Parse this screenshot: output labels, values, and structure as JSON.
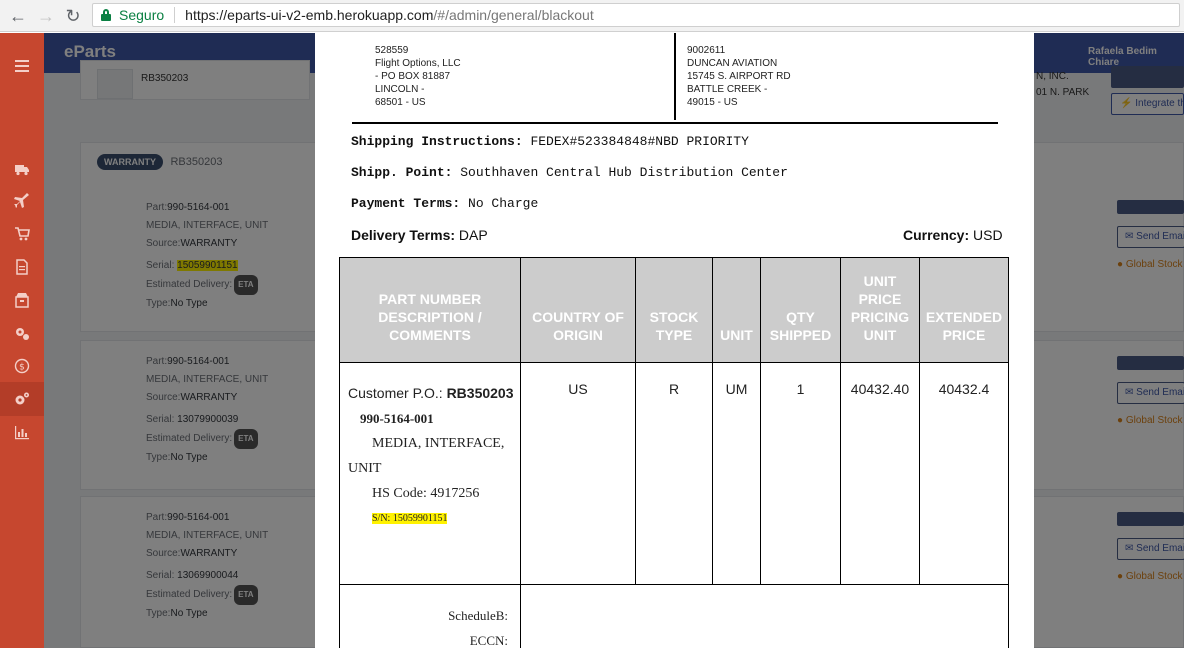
{
  "browser": {
    "secure_label": "Seguro",
    "url_host": "https://eparts-ui-v2-emb.herokuapp.com",
    "url_path": "/#/admin/general/blackout"
  },
  "app": {
    "brand": "eParts",
    "user": "Rafaela Bedim Chiare",
    "header_id": "RB350203",
    "right_partial_1": "N, INC.",
    "right_partial_2": "01 N. PARK",
    "integrate_label": "Integrate this",
    "send_email_label": "Send Email",
    "global_stock_label": "Global Stock"
  },
  "background_cards": [
    {
      "badge": "WARRANTY",
      "id": "RB350203",
      "part_label": "Part:",
      "part": "990-5164-001",
      "description": "MEDIA, INTERFACE, UNIT",
      "source_label": "Source:",
      "source": "WARRANTY",
      "serial_label": "Serial:",
      "serial": "15059901151",
      "eta_label": "Estimated Delivery:",
      "eta_badge": "ETA",
      "type_label": "Type:",
      "type": "No Type"
    },
    {
      "part_label": "Part:",
      "part": "990-5164-001",
      "description": "MEDIA, INTERFACE, UNIT",
      "source_label": "Source:",
      "source": "WARRANTY",
      "serial_label": "Serial:",
      "serial": "13079900039",
      "eta_label": "Estimated Delivery:",
      "eta_badge": "ETA",
      "type_label": "Type:",
      "type": "No Type"
    },
    {
      "part_label": "Part:",
      "part": "990-5164-001",
      "description": "MEDIA, INTERFACE, UNIT",
      "source_label": "Source:",
      "source": "WARRANTY",
      "serial_label": "Serial:",
      "serial": "13069900044",
      "eta_label": "Estimated Delivery:",
      "eta_badge": "ETA",
      "type_label": "Type:",
      "type": "No Type"
    }
  ],
  "document": {
    "ship_from": "528559\nFlight Options, LLC\n- PO BOX 81887\nLINCOLN -\n68501 - US",
    "ship_to": "9002611\nDUNCAN AVIATION\n15745 S. AIRPORT RD\nBATTLE CREEK -\n49015 - US",
    "shipping_instructions_label": "Shipping Instructions:",
    "shipping_instructions": "FEDEX#523384848#NBD PRIORITY",
    "shipping_point_label": "Shipp. Point:",
    "shipping_point": "Southhaven Central Hub Distribution Center",
    "payment_terms_label": "Payment Terms:",
    "payment_terms": "No Charge",
    "delivery_terms_label": "Delivery Terms:",
    "delivery_terms": "DAP",
    "currency_label": "Currency:",
    "currency": "USD",
    "columns": [
      "PART NUMBER DESCRIPTION / COMMENTS",
      "COUNTRY OF ORIGIN",
      "STOCK TYPE",
      "UNIT",
      "QTY SHIPPED",
      "UNIT PRICE PRICING UNIT",
      "EXTENDED PRICE"
    ],
    "row": {
      "customer_po_label": "Customer P.O.:",
      "customer_po": "RB350203",
      "part_number": "990-5164-001",
      "desc_line1": "MEDIA, INTERFACE,",
      "desc_line2": "UNIT",
      "hs_code": "HS Code: 4917256",
      "serial": "S/N: 15059901151",
      "country": "US",
      "stock_type": "R",
      "unit": "UM",
      "qty": "1",
      "unit_price": "40432.40",
      "extended_price": "40432.4"
    },
    "schedule_b_label": "ScheduleB:",
    "eccn_label": "ECCN:"
  },
  "colors": {
    "sidebar": "#c6472f",
    "topbar": "#3f58a8",
    "highlight": "#fff200",
    "table_header": "#cccccc"
  },
  "sidebar_icons": [
    "menu-icon",
    "truck-icon",
    "plane-icon",
    "cart-icon",
    "document-icon",
    "box-icon",
    "settings-icon",
    "dollar-icon",
    "gears-icon",
    "chart-icon"
  ]
}
